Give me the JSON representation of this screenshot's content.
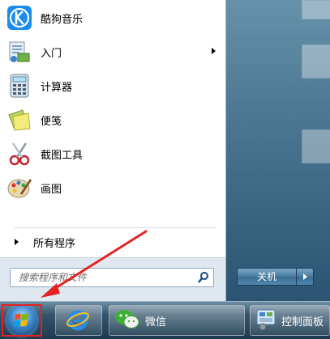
{
  "start_menu": {
    "programs": [
      {
        "label": "酷狗音乐",
        "icon": "kugou-icon"
      },
      {
        "label": "入门",
        "icon": "getting-started-icon",
        "has_submenu": true
      },
      {
        "label": "计算器",
        "icon": "calculator-icon"
      },
      {
        "label": "便笺",
        "icon": "sticky-notes-icon"
      },
      {
        "label": "截图工具",
        "icon": "snipping-tool-icon"
      },
      {
        "label": "画图",
        "icon": "paint-icon"
      }
    ],
    "all_programs_label": "所有程序",
    "search_placeholder": "搜索程序和文件",
    "shutdown_label": "关机"
  },
  "taskbar": {
    "items": [
      {
        "label": "",
        "icon": "internet-explorer-icon"
      },
      {
        "label": "微信",
        "icon": "wechat-icon"
      },
      {
        "label": "控制面板",
        "icon": "control-panel-icon"
      }
    ]
  },
  "colors": {
    "annotation_red": "#e52222",
    "taskbar": "#1e3a51",
    "menu_bg": "#ffffff"
  }
}
